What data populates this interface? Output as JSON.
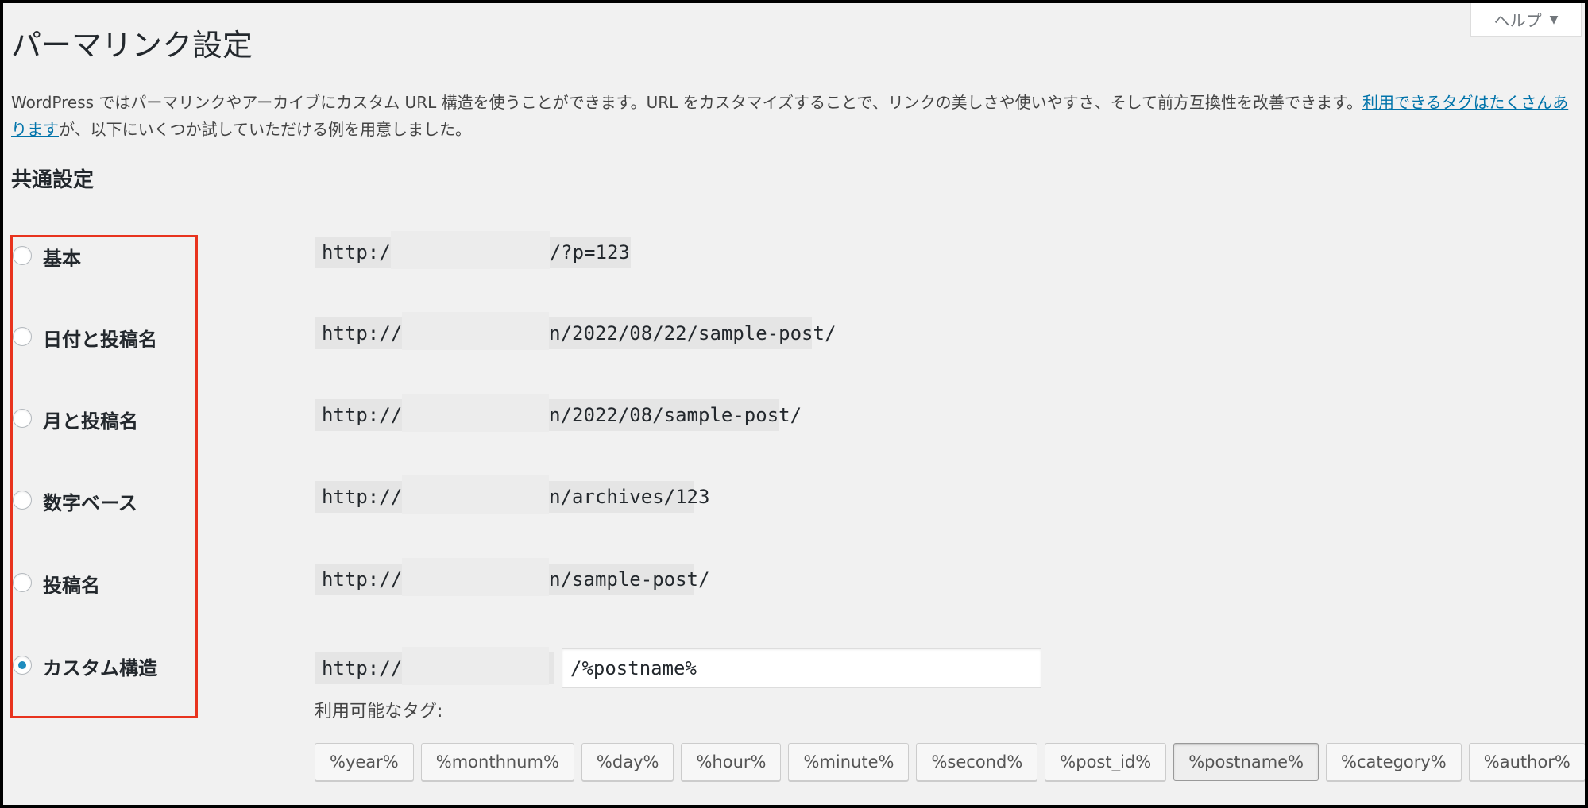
{
  "help_tab": {
    "label": "ヘルプ",
    "caret": "▼"
  },
  "page_title": "パーマリンク設定",
  "description": {
    "text": "WordPress ではパーマリンクやアーカイブにカスタム URL 構造を使うことができます。URL をカスタマイズすることで、リンクの美しさや使いやすさ、そして前方互換性を改善できます。",
    "link_text": "利用できるタグはたくさんあります",
    "suffix": "が、以下にいくつか試していただける例を用意しました。"
  },
  "section_heading": "共通設定",
  "options": [
    {
      "label": "基本",
      "url_prefix": "http:/",
      "url_suffix": "/?p=123",
      "checked": false
    },
    {
      "label": "日付と投稿名",
      "url_prefix": "http://",
      "url_suffix": "n/2022/08/22/sample-post/",
      "checked": false
    },
    {
      "label": "月と投稿名",
      "url_prefix": "http://",
      "url_suffix": "n/2022/08/sample-post/",
      "checked": false
    },
    {
      "label": "数字ベース",
      "url_prefix": "http://",
      "url_suffix": "n/archives/123",
      "checked": false
    },
    {
      "label": "投稿名",
      "url_prefix": "http://",
      "url_suffix": "n/sample-post/",
      "checked": false
    },
    {
      "label": "カスタム構造",
      "url_prefix": "http://",
      "url_suffix": "",
      "checked": true
    }
  ],
  "custom_structure_value": "/%postname%",
  "tags_label": "利用可能なタグ:",
  "tags": [
    {
      "label": "%year%",
      "active": false
    },
    {
      "label": "%monthnum%",
      "active": false
    },
    {
      "label": "%day%",
      "active": false
    },
    {
      "label": "%hour%",
      "active": false
    },
    {
      "label": "%minute%",
      "active": false
    },
    {
      "label": "%second%",
      "active": false
    },
    {
      "label": "%post_id%",
      "active": false
    },
    {
      "label": "%postname%",
      "active": true
    },
    {
      "label": "%category%",
      "active": false
    },
    {
      "label": "%author%",
      "active": false
    }
  ],
  "colors": {
    "highlight": "#e8331e",
    "link": "#0073aa",
    "radio_checked": "#1e8cbe"
  }
}
